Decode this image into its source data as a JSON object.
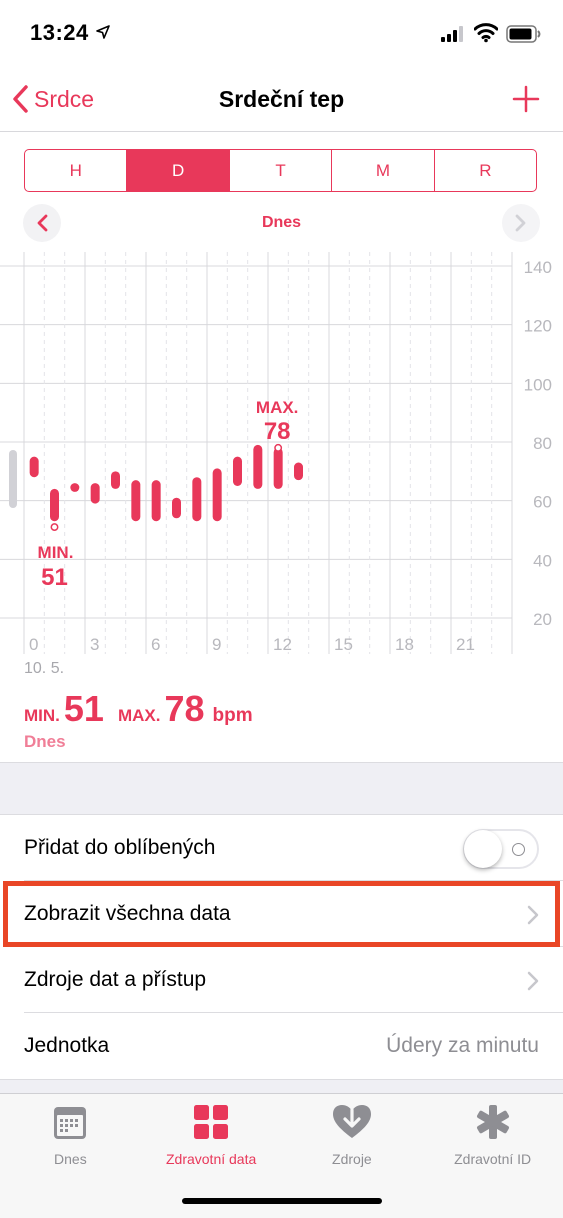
{
  "status_bar": {
    "time": "13:24"
  },
  "nav": {
    "back_label": "Srdce",
    "title": "Srdeční tep"
  },
  "segments": [
    "H",
    "D",
    "T",
    "M",
    "R"
  ],
  "selected_segment": "D",
  "date_label": "Dnes",
  "chart_data": {
    "type": "range-bar",
    "x": [
      0,
      1,
      2,
      3,
      4,
      5,
      6,
      7,
      8,
      9,
      10,
      11,
      12,
      13
    ],
    "low": [
      68,
      53,
      63,
      59,
      64,
      53,
      53,
      54,
      53,
      53,
      65,
      64,
      64,
      67
    ],
    "high": [
      75,
      64,
      66,
      66,
      70,
      67,
      67,
      61,
      68,
      71,
      75,
      79,
      78,
      73
    ],
    "x_ticks": [
      "0",
      "3",
      "6",
      "9",
      "12",
      "15",
      "18",
      "21"
    ],
    "y_ticks": [
      "140",
      "120",
      "100",
      "80",
      "60",
      "40",
      "20"
    ],
    "ylim": [
      20,
      140
    ],
    "xlim": [
      0,
      24
    ],
    "min_annotation": {
      "label": "MIN.",
      "value": "51",
      "x": 1,
      "y": 51
    },
    "max_annotation": {
      "label": "MAX.",
      "value": "78",
      "x": 12,
      "y": 78
    },
    "color": "#e8385a"
  },
  "summary": {
    "date_small": "10. 5.",
    "min_label": "MIN.",
    "min_value": "51",
    "max_label": "MAX.",
    "max_value": "78",
    "unit": "bpm",
    "period": "Dnes"
  },
  "list": {
    "favorite": "Přidat do oblíbených",
    "show_all": "Zobrazit všechna data",
    "sources": "Zdroje dat a přístup",
    "unit_label": "Jednotka",
    "unit_value": "Údery za minutu"
  },
  "tabs": [
    {
      "label": "Dnes",
      "icon": "calendar-icon"
    },
    {
      "label": "Zdravotní data",
      "icon": "grid-icon"
    },
    {
      "label": "Zdroje",
      "icon": "heart-download-icon"
    },
    {
      "label": "Zdravotní ID",
      "icon": "medical-asterisk-icon"
    }
  ],
  "colors": {
    "accent": "#e8385a",
    "highlight": "#e94626"
  }
}
